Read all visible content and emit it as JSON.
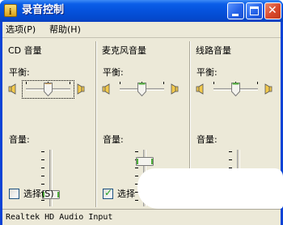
{
  "window": {
    "title": "录音控制",
    "app_icon": "mixer-icon",
    "controls": {
      "minimize": "minimize-icon",
      "maximize": "maximize-icon",
      "close": "close-icon"
    }
  },
  "menu": {
    "options": "选项(P)",
    "help": "帮助(H)"
  },
  "channels": [
    {
      "name": "CD 音量",
      "balance_label": "平衡:",
      "volume_label": "音量:",
      "select_label": "选择(S)",
      "selected": false,
      "balance": 0.5,
      "volume": 0.15
    },
    {
      "name": "麦克风音量",
      "balance_label": "平衡:",
      "volume_label": "音量:",
      "select_label": "选择",
      "selected": true,
      "balance": 0.5,
      "volume": 0.85
    },
    {
      "name": "线路音量",
      "balance_label": "平衡:",
      "volume_label": "音量:",
      "select_label": "",
      "selected": false,
      "balance": 0.5,
      "volume": 0.15
    }
  ],
  "status": {
    "text": "Realtek HD Audio Input"
  },
  "colors": {
    "titlebar": "#0552dc",
    "face": "#ece9d8",
    "slider_thumb": "#4fae3a",
    "close_button": "#d9482b"
  }
}
